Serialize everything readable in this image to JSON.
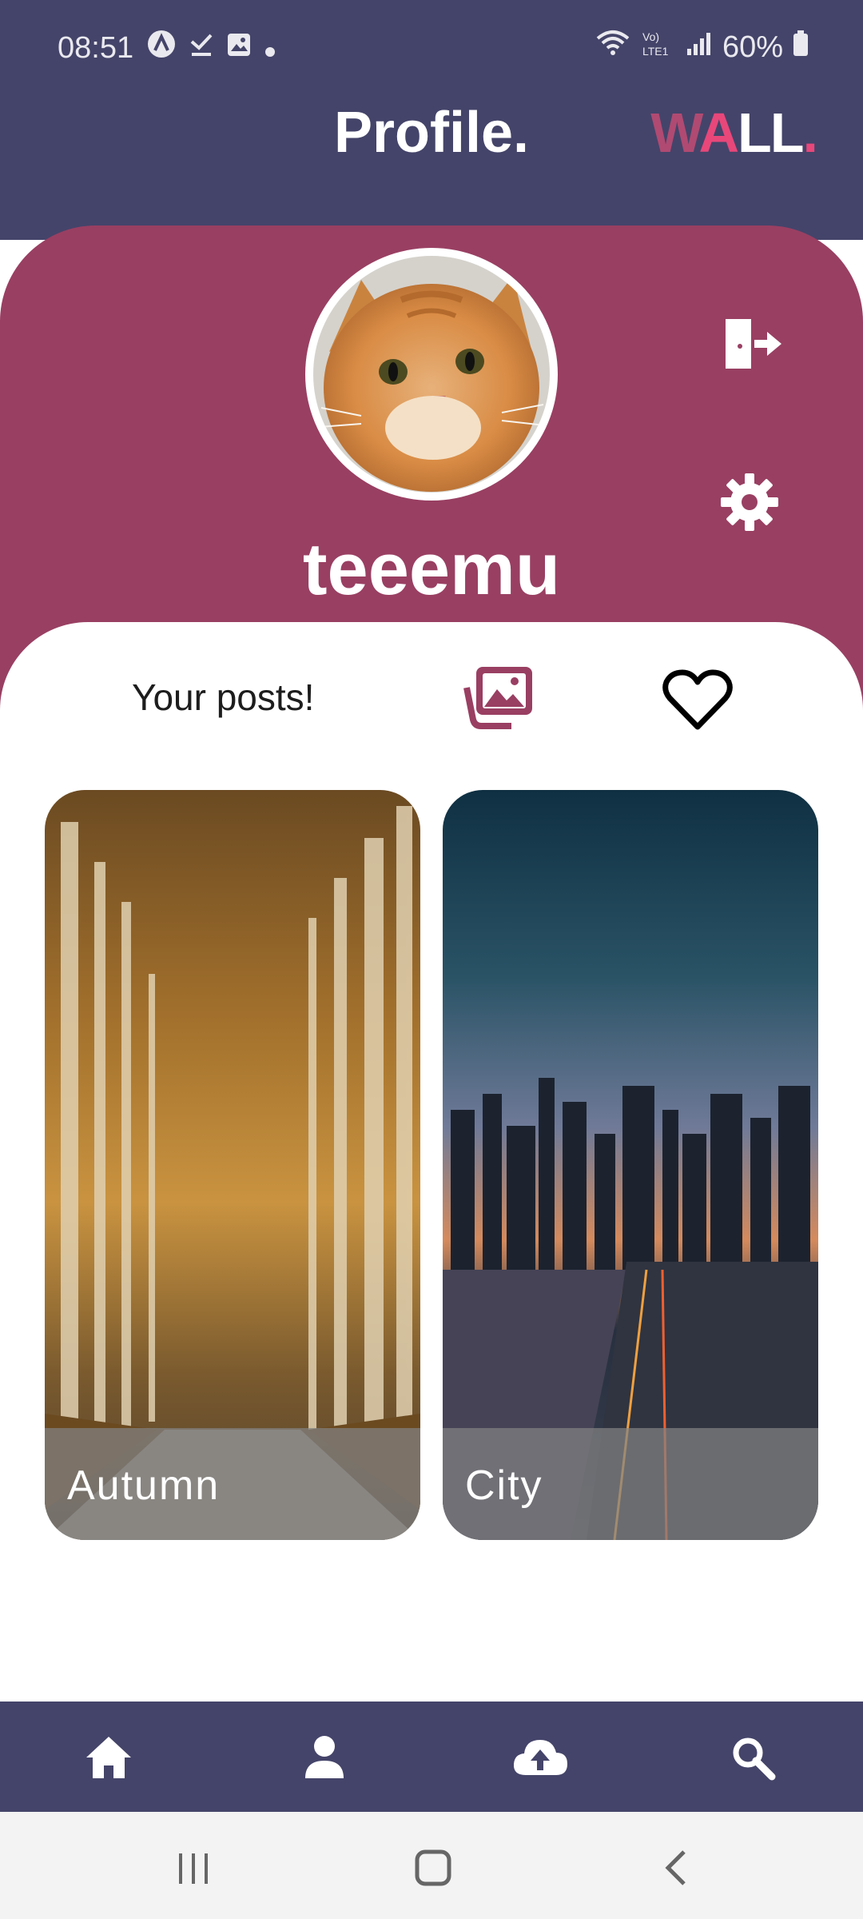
{
  "status_bar": {
    "time": "08:51",
    "battery": "60%",
    "signal_text": "Vo) LTE1",
    "icons": [
      "arc-notification-icon",
      "download-done-icon",
      "gallery-icon",
      "dot-icon",
      "wifi-calling-icon",
      "lte-signal-icon",
      "cell-signal-icon",
      "battery-icon"
    ]
  },
  "header": {
    "title": "Profile.",
    "brand": {
      "w": "W",
      "a": "A",
      "ll": "LL",
      "dot": "."
    }
  },
  "profile": {
    "username": "teeemu",
    "avatar_icon": "cat-avatar",
    "actions": [
      "logout-icon",
      "gear-icon"
    ]
  },
  "tabs": {
    "posts_label": "Your posts!",
    "gallery_icon": "gallery-stack-icon",
    "favorites_icon": "heart-icon"
  },
  "posts": [
    {
      "caption": "Autumn",
      "image": "autumn-forest-path"
    },
    {
      "caption": "City",
      "image": "city-skyline-sunset"
    }
  ],
  "bottom_nav": {
    "items": [
      "home-icon",
      "profile-icon",
      "upload-cloud-icon",
      "search-icon"
    ]
  },
  "system_nav": [
    "recents-icon",
    "home-button-icon",
    "back-icon"
  ],
  "colors": {
    "header_bg": "#44446a",
    "profile_bg": "#993f62",
    "brand_pink": "#e8477a",
    "panel_bg": "#ffffff"
  }
}
